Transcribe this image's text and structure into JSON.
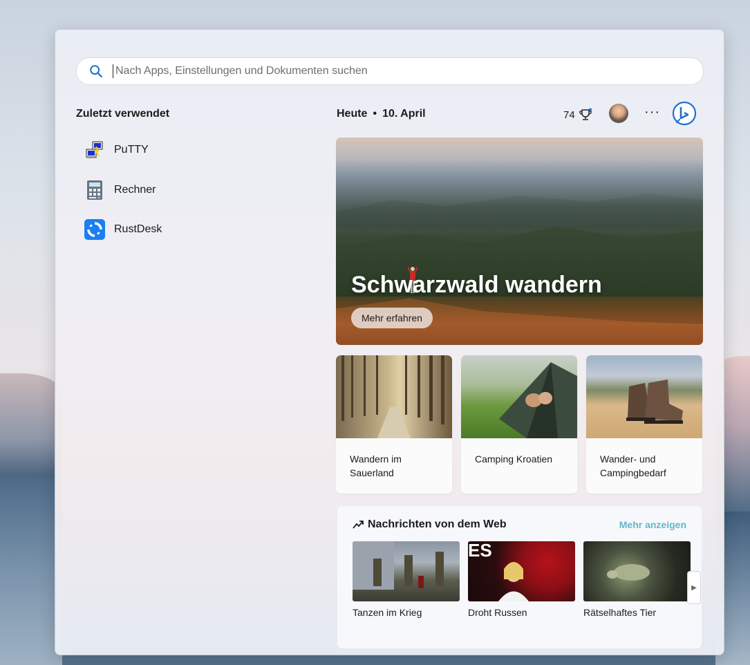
{
  "search": {
    "placeholder": "Nach Apps, Einstellungen und Dokumenten suchen"
  },
  "recent": {
    "title": "Zuletzt verwendet",
    "items": [
      {
        "label": "PuTTY",
        "icon": "putty-icon"
      },
      {
        "label": "Rechner",
        "icon": "calculator-icon"
      },
      {
        "label": "RustDesk",
        "icon": "rustdesk-icon"
      }
    ]
  },
  "header": {
    "today": "Heute",
    "dot": "•",
    "date": "10. April",
    "points": "74",
    "more": "···"
  },
  "hero": {
    "title": "Schwarzwald wandern",
    "button": "Mehr erfahren"
  },
  "cards": [
    {
      "label": "Wandern im Sauerland"
    },
    {
      "label": "Camping Kroatien"
    },
    {
      "label": "Wander- und Campingbedarf"
    }
  ],
  "news": {
    "title": "Nachrichten von dem Web",
    "more": "Mehr anzeigen",
    "items": [
      {
        "caption": "Tanzen im Krieg"
      },
      {
        "caption": "Droht Russen"
      },
      {
        "caption": "Rätselhaftes Tier"
      }
    ]
  },
  "colors": {
    "accent": "#1f6fd1",
    "link": "#5fb8cc"
  }
}
